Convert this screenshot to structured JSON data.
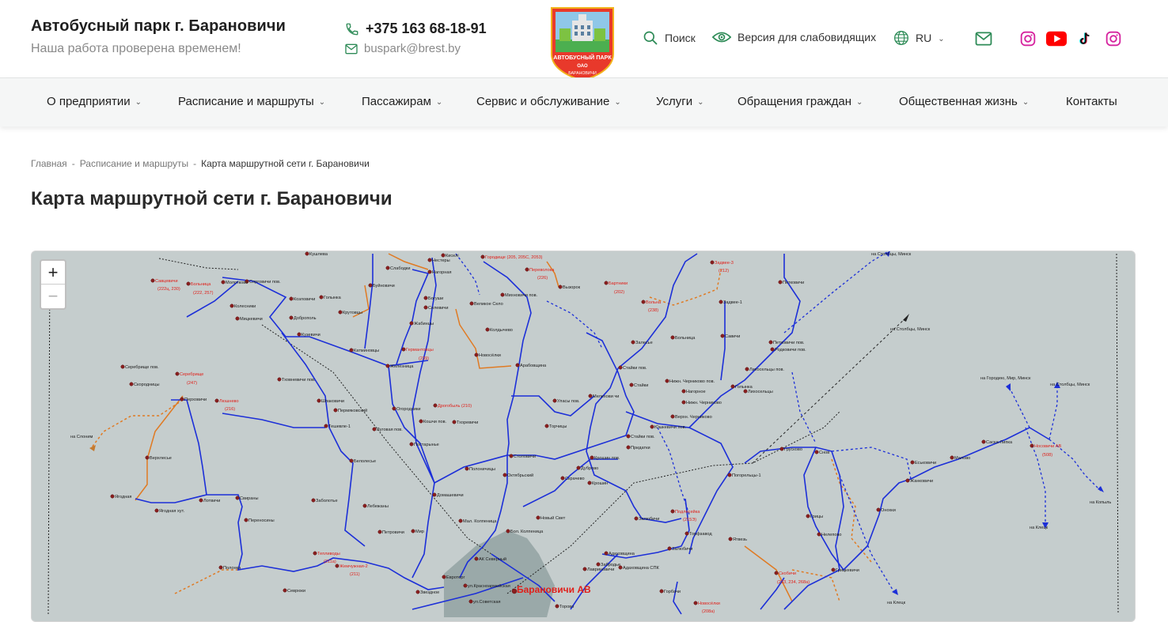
{
  "header": {
    "title": "Автобусный парк г. Барановичи",
    "slogan": "Наша работа проверена временем!",
    "phone": "+375 163 68-18-91",
    "email": "buspark@brest.by",
    "logo": {
      "line1": "АВТОБУСНЫЙ ПАРК",
      "line2": "ОАО",
      "line3": "БАРАНОВИЧИ"
    },
    "search_label": "Поиск",
    "accessibility_label": "Версия для слабовидящих",
    "language": "RU"
  },
  "nav": {
    "items": [
      {
        "label": "О предприятии",
        "dropdown": true
      },
      {
        "label": "Расписание и маршруты",
        "dropdown": true
      },
      {
        "label": "Пассажирам",
        "dropdown": true
      },
      {
        "label": "Сервис и обслуживание",
        "dropdown": true
      },
      {
        "label": "Услуги",
        "dropdown": true
      },
      {
        "label": "Обращения граждан",
        "dropdown": true
      },
      {
        "label": "Общественная жизнь",
        "dropdown": true
      },
      {
        "label": "Контакты",
        "dropdown": false
      }
    ]
  },
  "breadcrumb": {
    "items": [
      "Главная",
      "Расписание и маршруты"
    ],
    "separator": "-",
    "current": "Карта маршрутной сети г. Барановичи"
  },
  "page_title": "Карта маршрутной сети г. Барановичи",
  "map": {
    "zoom_in": "+",
    "zoom_out": "−",
    "labels": {
      "kushleva": "Кушлева",
      "slobodki": "Слабодки",
      "nestery": "Нестеры",
      "kiseli": "Киселі",
      "nagornaya": "Нагорная",
      "gorodische": "Городище (205, 205С, 2053)",
      "perevoloka": "Переволока",
      "perevoloka_num": "(226)",
      "vyzorok": "Вызорок",
      "savtsevichi": "Савцевичи",
      "savtsevichi_num": "(222ц, 230)",
      "bolnitsa1": "Больница",
      "bolnitsa1_num": "(222, 257)",
      "molotkovo": "Молотково",
      "sorgovichi": "Сорговичи пов.",
      "golynka": "Голынка",
      "buinovichi": "Буйновичи",
      "kozlovichi": "Козловичи",
      "dobropol": "Доброполь",
      "kolesniki": "Колесники",
      "mitskevichi": "Мицкевичи",
      "krutovtsy": "Крутовцы",
      "bogushi": "Богуши",
      "selevichi": "Селевичи",
      "zhabintsy": "Жабинцы",
      "velikoe_selo": "Великое Село",
      "mikhnovichi": "Михновичи пов.",
      "koldychevo": "Колдычево",
      "bartniki": "Бартники",
      "bartniki_num": "(202)",
      "volna": "Вольна",
      "volna_num": "(238)",
      "zadvee3": "Задвее-3",
      "zadvee3_num": "(212)",
      "zadvee1": "Задвее-1",
      "petkovichi": "Петковичи",
      "zalesye": "Залесье",
      "bolnitsa2": "Больница",
      "savichi": "Савичи",
      "kuzevichi": "Кузевичи",
      "katminovtsy": "Катминовцы",
      "germantovtsy": "Германтовцы",
      "germantovtsy_num": "(239)",
      "novoselki": "Новосёлки",
      "arabovshchina": "Арабовщина",
      "staiki_pov": "Стайки пов.",
      "zheleznitsa": "Железница",
      "petkovichi_pov": "Петковичи пов.",
      "rudkovichi": "Родковичи пов.",
      "likhoseltsy_pov": "Лихосельцы пов.",
      "serebrische_pov": "Серебрище пов.",
      "serebrische": "Серебрище",
      "serebrische_num": "(247)",
      "skorodnitsy": "Скородницы",
      "tkhovnevichi": "Тховневичи пов.",
      "staiki": "Стайки",
      "nizh_chernikovo": "Нижн. Черниково пов.",
      "nagornoe": "Нагорное",
      "golynka2": "Голынка",
      "likhoseltsy": "Лихосельцы",
      "nizh_chernikovo2": "Нижн. Черниково",
      "perkhovichi": "Перховичи",
      "lyushnevo": "Люшнево",
      "lyushnevo_num": "(216)",
      "shpakovichi": "Шпаковичи",
      "permyakskiy": "Пермяковский",
      "ogorodniki": "Огородники",
      "drogobyl": "Дрогобыль (210)",
      "ulasy": "Уласы пов.",
      "melekhovichi": "Мелехови чи",
      "verkh_chernikovo": "Верхн. Черниково",
      "na_slonim": "на Слоним",
      "teshevle1": "Тешевле-1",
      "koshchi": "Кошчи пов.",
      "tkhorevichi": "Тхоревичи",
      "yushkevichi": "Юшкевичи пов.",
      "lugovaya": "Луговая пов.",
      "torchitsy": "Торчицы",
      "staiki_pov2": "Стайки пов.",
      "pridatki": "Придатки",
      "grushevo": "Грусково",
      "snov": "Снов",
      "na_stolbtsy": "на Столбцы, Минск",
      "na_stolbtsy2": "на Столбцы, Минск",
      "na_stolbtsy3": "на Столбцы, Минск",
      "na_gorodeyu": "на Городею, Мир, Минск",
      "verkhlesye": "Верхлесье",
      "postarinye": "Постарынье",
      "stolovichi": "Столовичи",
      "krushin": "Крошин пов.",
      "dubrovo": "Дуброво",
      "beloleseye": "Белолесье",
      "polonechitsy": "Полоничицы",
      "oktyabrsky": "Октябрьский",
      "skrachevo": "Скрачево",
      "krushin2": "Крошин",
      "pogoreltsy": "Погорельцы-1",
      "malovo": "Малово",
      "saska_lipka": "Саска-Липка",
      "yeskovichi": "Еськовичи",
      "zhankovichi": "Жанковичи",
      "nosovichi": "Носовичи АВ",
      "nosovichi_num": "(508)",
      "na_kopyl": "на Копыль",
      "na_kletsk": "на Клецк",
      "na_kletsk2": "на Клецк",
      "yagodnaya": "Ягодная",
      "yagodnaya_khut": "Ягодная хут.",
      "lotvichi": "Лотвичи",
      "svirany": "Свираны",
      "zabolotye": "Заболотье",
      "lebezhany": "Лебежаны",
      "domashevichi": "Домашевичи",
      "mal_kolpenitsa": "Мал. Колпеница",
      "novy_svet": "Новый Свет",
      "zalyubichi": "Залюбичи",
      "podlesye": "Подлесейка",
      "podlesye_num": "(215Э)",
      "oshki": "Онохки",
      "peresonchi": "Переносины",
      "bol_kolpenitsa": "Бол. Колпеница",
      "torfzavod": "Торфзавод",
      "gritsy": "Грицы",
      "nelepovo": "Нелепово",
      "petrovichi": "Петровичи",
      "mir": "Мир",
      "yatvezi": "Ятвезь",
      "teplivody": "Тепливоды",
      "teplivody_num": "(211а)",
      "zhemchuzhnaya": "Жемчужная-2",
      "zhemchuzhnaya_num": "(211)",
      "polonka": "Полонка",
      "ak_severny": "АК Северный",
      "adakhovshchina": "Адаховщина",
      "zalyubichi2": "Залюбичи",
      "zabrodye": "Забродье",
      "lavrinovichi": "Лавриновичи",
      "adakhovshchina_spk": "Адаховщина СПК",
      "gritskevichi": "Грицкевичи",
      "skobichi": "Скобичи",
      "skobichi_num": "(233, 234, 268а)",
      "evrotorg": "Евроторг",
      "baranovichi_av": "Барановичи АВ",
      "zvezdnoe": "Звездное",
      "ul_krasnoarmeyskaya": "ул.Красноармейская",
      "ul_sovetskaya": "ул.Советская",
      "gorbachi": "Горбачи",
      "novoselki2": "Новосёлки",
      "novoselki2_num": "(208а)",
      "torovo": "Торово",
      "na_kletsk3": "на Клецк",
      "sevrjuki": "Севрюки"
    }
  }
}
